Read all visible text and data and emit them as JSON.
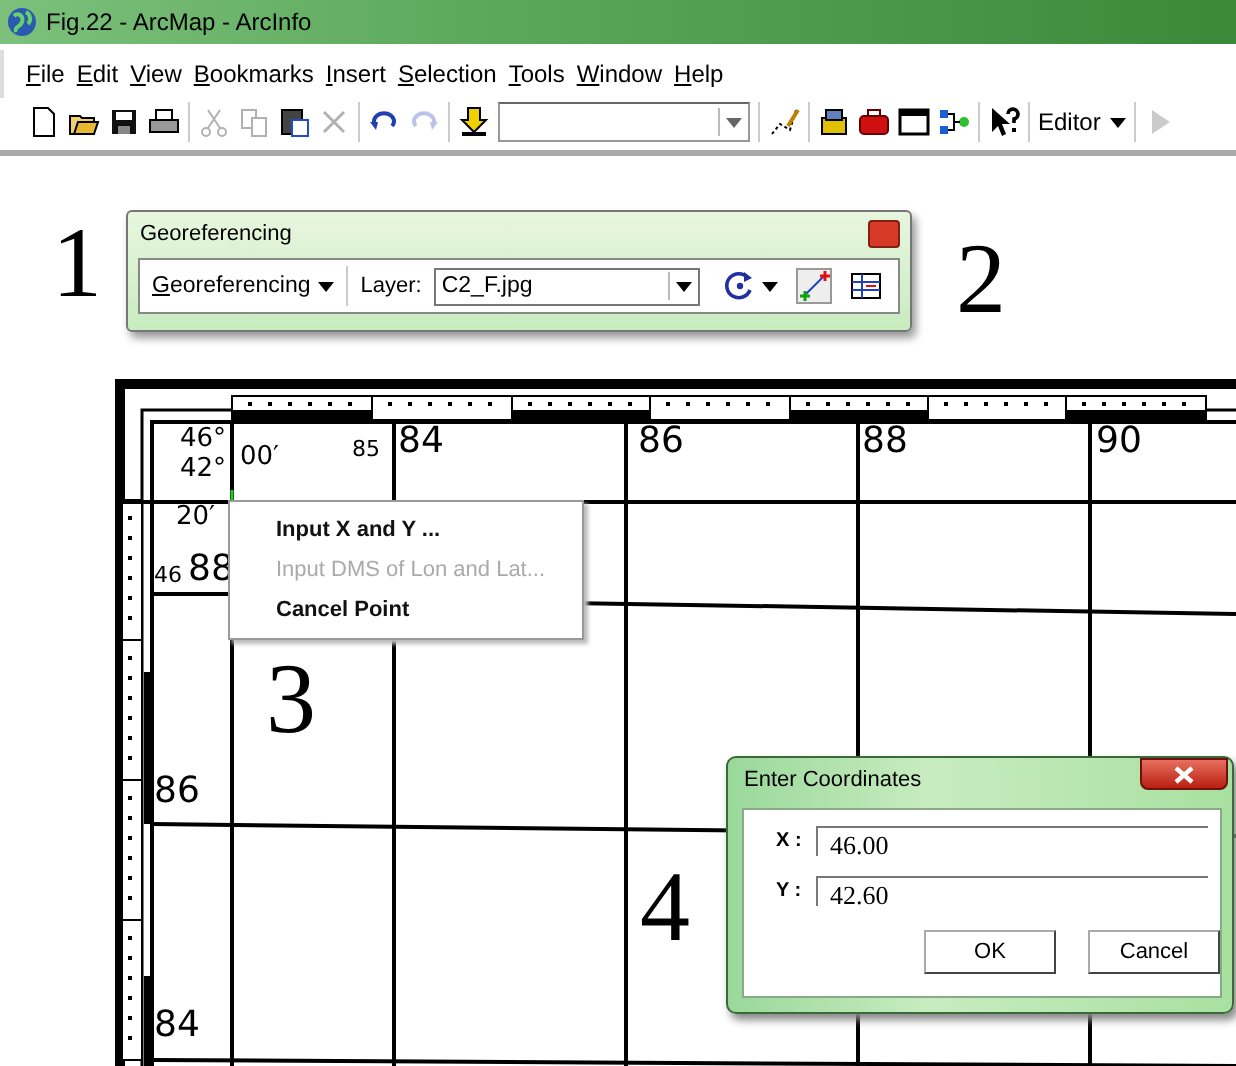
{
  "window": {
    "title": "Fig.22 - ArcMap - ArcInfo"
  },
  "menu_bar": [
    "File",
    "Edit",
    "View",
    "Bookmarks",
    "Insert",
    "Selection",
    "Tools",
    "Window",
    "Help"
  ],
  "toolbar": {
    "groups": [
      [
        {
          "kind": "new",
          "disabled": false
        },
        {
          "kind": "open",
          "disabled": false
        },
        {
          "kind": "save",
          "disabled": false
        },
        {
          "kind": "print",
          "disabled": false
        }
      ],
      [
        {
          "kind": "cut",
          "disabled": true
        },
        {
          "kind": "copy",
          "disabled": true
        },
        {
          "kind": "paste",
          "disabled": false
        },
        {
          "kind": "delete",
          "disabled": true
        }
      ],
      [
        {
          "kind": "undo",
          "disabled": false
        },
        {
          "kind": "redo",
          "disabled": true
        }
      ],
      [
        {
          "kind": "add-data",
          "disabled": false
        },
        {
          "kind": "scale",
          "disabled": false
        }
      ],
      [
        {
          "kind": "editor-toolbar",
          "disabled": false
        }
      ],
      [
        {
          "kind": "catalog",
          "disabled": false
        },
        {
          "kind": "toolbox",
          "disabled": false
        },
        {
          "kind": "command-line",
          "disabled": false
        },
        {
          "kind": "model",
          "disabled": false
        }
      ],
      [
        {
          "kind": "whats-this",
          "disabled": false
        }
      ],
      [
        {
          "kind": "editor-menu",
          "label": "Editor",
          "disabled": false
        }
      ],
      [
        {
          "kind": "play",
          "disabled": true
        }
      ]
    ]
  },
  "annotations": [
    "1",
    "2",
    "3",
    "4"
  ],
  "georeferencing": {
    "title": "Georeferencing",
    "menu": "Georeferencing",
    "layer_label": "Layer:",
    "layer": "C2_F.jpg",
    "tools": [
      {
        "kind": "rotate-menu",
        "on": false
      },
      {
        "kind": "add-control-points",
        "on": true
      },
      {
        "kind": "link-table",
        "on": false
      }
    ]
  },
  "map": {
    "labels": [
      {
        "text": "46°",
        "kind": "minor"
      },
      {
        "text": "42°",
        "kind": "minor"
      },
      {
        "text": "00′",
        "kind": "minor"
      },
      {
        "text": "85",
        "kind": "small"
      },
      {
        "text": "84",
        "kind": "major"
      },
      {
        "text": "86",
        "kind": "major"
      },
      {
        "text": "88",
        "kind": "major"
      },
      {
        "text": "90",
        "kind": "major"
      },
      {
        "text": "20′",
        "kind": "minor"
      },
      {
        "text": "46",
        "kind": "small"
      },
      {
        "text": "88",
        "kind": "major"
      },
      {
        "text": "86",
        "kind": "major"
      },
      {
        "text": "84",
        "kind": "major"
      }
    ]
  },
  "context_menu": {
    "items": [
      {
        "label": "Input X and Y ...",
        "disabled": false
      },
      {
        "label": "Input DMS of Lon and Lat...",
        "disabled": true
      },
      {
        "label": "Cancel Point",
        "disabled": false
      }
    ]
  },
  "dialog": {
    "title": "Enter Coordinates",
    "fields": [
      {
        "label": "X :",
        "value": "46.00"
      },
      {
        "label": "Y :",
        "value": "42.60"
      }
    ],
    "buttons": [
      "OK",
      "Cancel"
    ]
  }
}
